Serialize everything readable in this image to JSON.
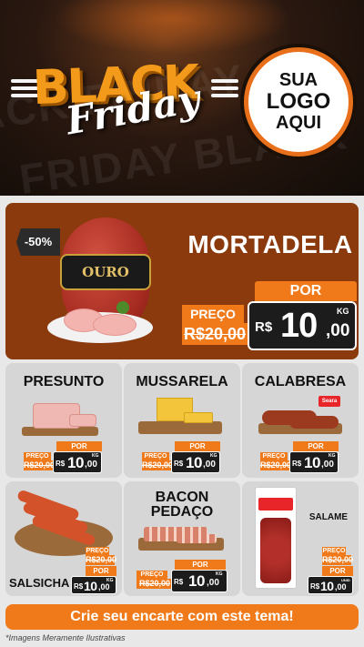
{
  "header": {
    "background_text": [
      "ACK FRIDAY",
      "FRIDAY BLACK"
    ],
    "black_word": "BLACK",
    "friday_word": "Friday",
    "logo_lines": [
      "SUA",
      "LOGO",
      "AQUI"
    ]
  },
  "featured": {
    "discount": "-50%",
    "title": "MORTADELA",
    "brand_label": "OURO",
    "por_label": "POR",
    "preco_label": "PREÇO",
    "old_price": "R$20,00",
    "currency": "R$",
    "new_price_int": "10",
    "new_price_cents": ",00",
    "unit": "KG"
  },
  "cards": [
    {
      "name": "PRESUNTO",
      "por": "POR",
      "preco": "PREÇO",
      "old": "R$20,00",
      "cur": "R$",
      "int": "10",
      "cents": ",00",
      "unit": "KG"
    },
    {
      "name": "MUSSARELA",
      "por": "POR",
      "preco": "PREÇO",
      "old": "R$20,00",
      "cur": "R$",
      "int": "10",
      "cents": ",00",
      "unit": "KG"
    },
    {
      "name": "CALABRESA",
      "por": "POR",
      "preco": "PREÇO",
      "old": "R$20,00",
      "cur": "R$",
      "int": "10",
      "cents": ",00",
      "unit": "KG",
      "brand": "Seara"
    },
    {
      "name": "SALSICHA",
      "por": "POR",
      "preco": "PREÇO",
      "old": "R$20,00",
      "cur": "R$",
      "int": "10",
      "cents": ",00",
      "unit": "KG"
    },
    {
      "name": "BACON PEDAÇO",
      "por": "POR",
      "preco": "PREÇO",
      "old": "R$20,00",
      "cur": "R$",
      "int": "10",
      "cents": ",00",
      "unit": "KG"
    },
    {
      "name": "SALAME",
      "por": "POR",
      "preco": "PREÇO",
      "old": "R$20,00",
      "cur": "R$",
      "int": "10",
      "cents": ",00",
      "unit": "UNID"
    }
  ],
  "footer": {
    "cta": "Crie seu encarte com este tema!",
    "disclaimer": "*Imagens Meramente Ilustrativas"
  },
  "colors": {
    "accent": "#f07a1a",
    "featured_bg": "#8b3a0d",
    "card_bg": "#d6d6d6",
    "price_box": "#1c1c1c"
  }
}
